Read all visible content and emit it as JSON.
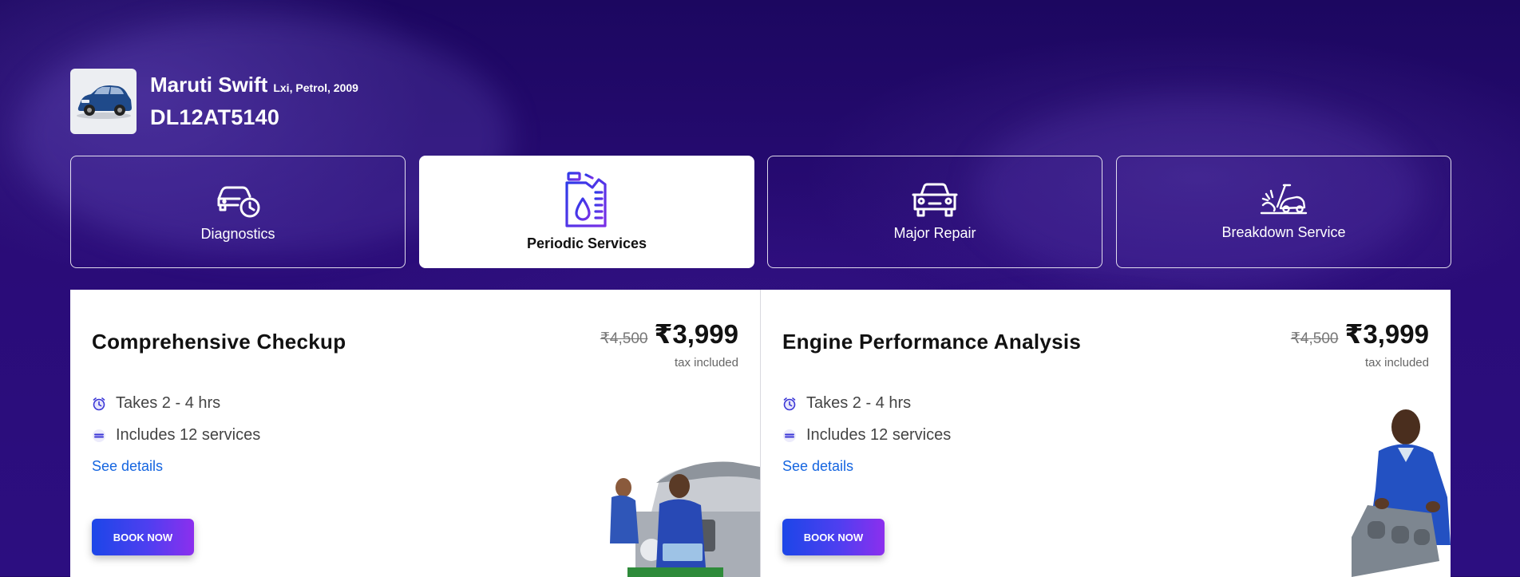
{
  "vehicle": {
    "name": "Maruti Swift",
    "variant": "Lxi, Petrol, 2009",
    "plate": "DL12AT5140"
  },
  "tabs": [
    {
      "label": "Diagnostics",
      "icon": "car-clock-icon",
      "active": false
    },
    {
      "label": "Periodic Services",
      "icon": "oil-can-icon",
      "active": true
    },
    {
      "label": "Major Repair",
      "icon": "car-front-icon",
      "active": false
    },
    {
      "label": "Breakdown Service",
      "icon": "car-crash-icon",
      "active": false
    }
  ],
  "services": [
    {
      "title": "Comprehensive Checkup",
      "old_price": "₹4,500",
      "price": "₹3,999",
      "tax_note": "tax included",
      "duration": "Takes 2 - 4 hrs",
      "includes": "Includes 12 services",
      "details_label": "See details",
      "book_label": "BOOK NOW"
    },
    {
      "title": "Engine Performance Analysis",
      "old_price": "₹4,500",
      "price": "₹3,999",
      "tax_note": "tax included",
      "duration": "Takes 2 - 4 hrs",
      "includes": "Includes 12 services",
      "details_label": "See details",
      "book_label": "BOOK NOW"
    }
  ],
  "colors": {
    "background": "#22086a",
    "accent_gradient_start": "#1c46e8",
    "accent_gradient_end": "#8c2fee",
    "link": "#1565e0",
    "oil_icon": "#3a2ee0"
  }
}
